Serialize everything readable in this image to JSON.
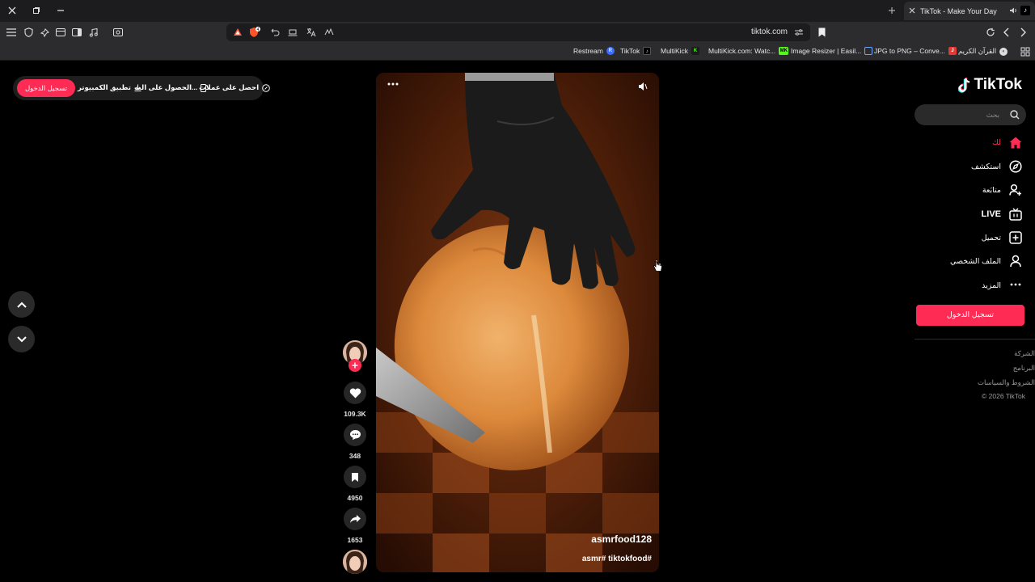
{
  "browser": {
    "tab_title": "TikTok - Make Your Day",
    "url": "tiktok.com"
  },
  "bookmarks": [
    {
      "label": "Restream",
      "icon": "R"
    },
    {
      "label": "TikTok",
      "icon": "♪"
    },
    {
      "label": "MultiKick",
      "icon": "K"
    },
    {
      "label": "MultiKick.com: Watc...",
      "icon": "MK"
    },
    {
      "label": "Image Resizer | Easil...",
      "icon": ""
    },
    {
      "label": "JPG to PNG – Conve...",
      "icon": "J"
    },
    {
      "label": "القرآن الكريم",
      "icon": "◐"
    }
  ],
  "top_pill": {
    "login": "تسجيل الدخول",
    "desktop_app": "تطبيق الكمبيوتر",
    "get_app": "الحصول على الت...",
    "coins": "احصل على عملات"
  },
  "video": {
    "username": "asmrfood128",
    "hashtags": "asmr# tiktokfood#"
  },
  "actions": {
    "likes": "109.3K",
    "comments": "348",
    "saves": "4950",
    "shares": "1653"
  },
  "sidebar": {
    "logo": "TikTok",
    "search_placeholder": "بحث",
    "items": [
      {
        "label": "لك",
        "icon": "home-icon"
      },
      {
        "label": "استكشف",
        "icon": "compass-icon"
      },
      {
        "label": "متابَعة",
        "icon": "following-icon"
      },
      {
        "label": "LIVE",
        "icon": "live-icon"
      },
      {
        "label": "تحميل",
        "icon": "upload-icon"
      },
      {
        "label": "الملف الشخصي",
        "icon": "profile-icon"
      },
      {
        "label": "المزيد",
        "icon": "more-icon"
      }
    ],
    "login": "تسجيل الدخول",
    "footer": [
      "الشركة",
      "البرنامج",
      "الشروط والسياسات",
      "© 2026 TikTok"
    ]
  },
  "colors": {
    "accent": "#fe2c55",
    "background": "#000000",
    "chrome": "#2c2c2e"
  }
}
